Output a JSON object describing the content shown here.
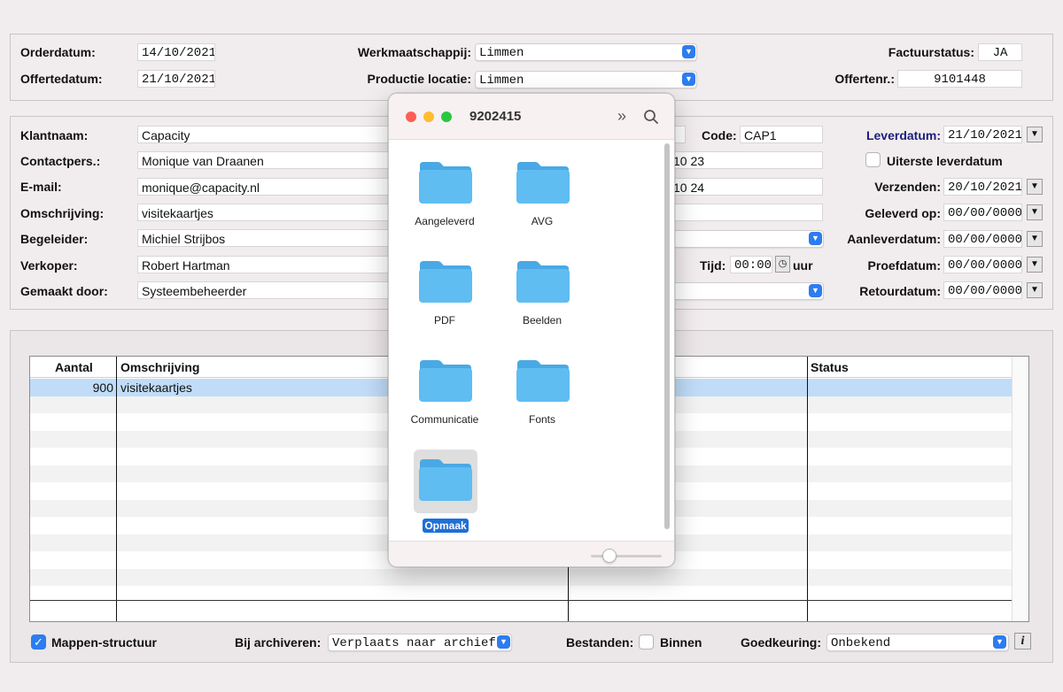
{
  "top": {
    "orderdatum_label": "Orderdatum:",
    "orderdatum": "14/10/2021",
    "offertedatum_label": "Offertedatum:",
    "offertedatum": "21/10/2021",
    "werkmaatschappij_label": "Werkmaatschappij:",
    "werkmaatschappij": "Limmen",
    "productie_label": "Productie locatie:",
    "productie": "Limmen",
    "factuurstatus_label": "Factuurstatus:",
    "factuurstatus": "JA",
    "offertenr_label": "Offertenr.:",
    "offertenr": "9101448"
  },
  "customer": {
    "klantnaam_label": "Klantnaam:",
    "klantnaam": "Capacity",
    "contactpers_label": "Contactpers.:",
    "contactpers": "Monique van Draanen",
    "email_label": "E-mail:",
    "email": "monique@capacity.nl",
    "omschrijving_label": "Omschrijving:",
    "omschrijving": "visitekaartjes",
    "begeleider_label": "Begeleider:",
    "begeleider": "Michiel Strijbos",
    "verkoper_label": "Verkoper:",
    "verkoper": "Robert Hartman",
    "gemaakt_label": "Gemaakt door:",
    "gemaakt": "Systeembeheerder",
    "code_label": "Code:",
    "code": "CAP1",
    "phone1": "10 23",
    "phone2": "10 24",
    "tijd_label": "Tijd:",
    "tijd": "00:00",
    "uur_label": "uur"
  },
  "dates": {
    "leverdatum_label": "Leverdatum:",
    "leverdatum": "21/10/2021",
    "uiterste_label": "Uiterste leverdatum",
    "verzenden_label": "Verzenden:",
    "verzenden": "20/10/2021",
    "geleverd_label": "Geleverd op:",
    "geleverd": "00/00/0000",
    "aanlever_label": "Aanleverdatum:",
    "aanlever": "00/00/0000",
    "proef_label": "Proefdatum:",
    "proef": "00/00/0000",
    "retour_label": "Retourdatum:",
    "retour": "00/00/0000"
  },
  "table": {
    "headers": [
      "Aantal",
      "Omschrijving",
      "Status"
    ],
    "rows": [
      {
        "aantal": "900",
        "omschrijving": "visitekaartjes",
        "status": ""
      }
    ]
  },
  "bottom": {
    "mappen_label": "Mappen-structuur",
    "archiveren_label": "Bij archiveren:",
    "archiveren_value": "Verplaats naar archief-map",
    "bestanden_label": "Bestanden:",
    "binnen_label": "Binnen",
    "goedkeuring_label": "Goedkeuring:",
    "goedkeuring_value": "Onbekend",
    "info_label": "i"
  },
  "finder": {
    "title": "9202415",
    "folders": [
      "Aangeleverd",
      "AVG",
      "PDF",
      "Beelden",
      "Communicatie",
      "Fonts",
      "Opmaak"
    ],
    "selected": "Opmaak",
    "colors": {
      "folder": "#5fbdf2",
      "folder_tab": "#4aa9e4",
      "selection": "#1f6fd6"
    }
  },
  "icons": {
    "close": "close-dot",
    "minimize": "minimize-dot",
    "zoom": "zoom-dot",
    "more": "chevron-double-right-icon",
    "search": "search-icon"
  }
}
